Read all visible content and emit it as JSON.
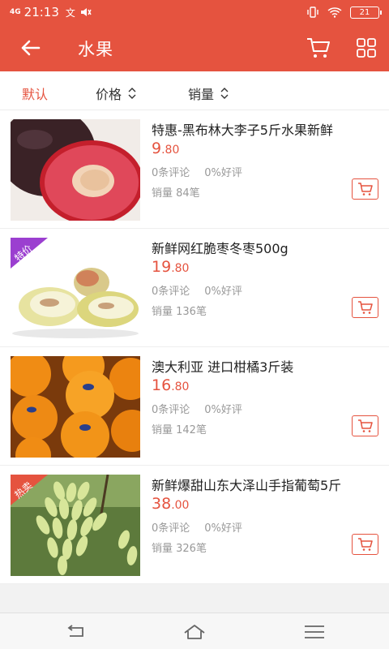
{
  "status_bar": {
    "signal": "4G",
    "time": "21:13",
    "misc": "文",
    "battery": "21"
  },
  "header": {
    "title": "水果"
  },
  "sort_bar": {
    "default": "默认",
    "price": "价格",
    "sales": "销量"
  },
  "products": [
    {
      "name": "特惠-黑布林大李子5斤水果新鲜",
      "price_int": "9",
      "price_dec": ".80",
      "reviews": "0条评论",
      "good_rate": "0%好评",
      "sales": "销量 84笔",
      "tag": ""
    },
    {
      "name": "新鲜网红脆枣冬枣500g",
      "price_int": "19",
      "price_dec": ".80",
      "reviews": "0条评论",
      "good_rate": "0%好评",
      "sales": "销量 136笔",
      "tag": "特价",
      "tag_color": "#9b3fd0"
    },
    {
      "name": "澳大利亚 进口柑橘3斤装",
      "price_int": "16",
      "price_dec": ".80",
      "reviews": "0条评论",
      "good_rate": "0%好评",
      "sales": "销量 142笔",
      "tag": ""
    },
    {
      "name": "新鲜爆甜山东大泽山手指葡萄5斤",
      "price_int": "38",
      "price_dec": ".00",
      "reviews": "0条评论",
      "good_rate": "0%好评",
      "sales": "销量 326笔",
      "tag": "热卖",
      "tag_color": "#e5533f"
    }
  ],
  "colors": {
    "accent": "#e5533f",
    "muted": "#999999"
  }
}
